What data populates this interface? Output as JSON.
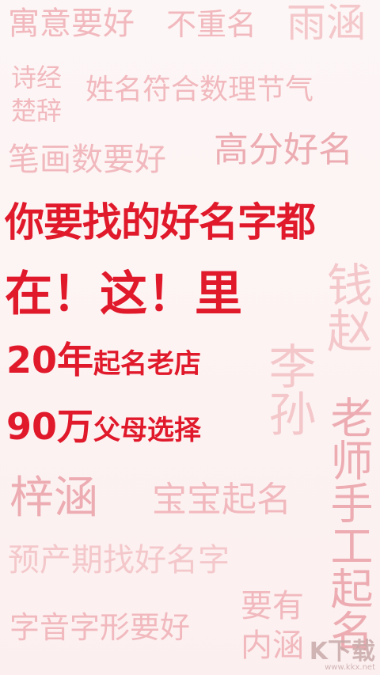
{
  "words": {
    "w1": "寓意要好",
    "w2": "不重名",
    "w3": "雨涵",
    "w4a": "诗经",
    "w4b": "楚辞",
    "w5": "姓名符合数理节气",
    "w6": "笔画数要好",
    "w7": "高分好名",
    "w8": "钱赵",
    "w9": "李孙",
    "w10": "老师手工起名",
    "w11": "梓涵",
    "w12": "宝宝起名",
    "w13": "预产期找好名字",
    "w14a": "要有",
    "w14b": "内涵",
    "w15": "字音字形要好"
  },
  "headline": {
    "line1": "你要找的好名字都",
    "line2": "在！这！里",
    "stat1_num": "20年",
    "stat1_text": "起名老店",
    "stat2_num": "90万",
    "stat2_text": "父母选择"
  },
  "watermark": {
    "logo": "K下载",
    "url": "www.kkx.net"
  },
  "colors": {
    "accent_red": "#e0192b",
    "soft_pink": "#f1b9be"
  }
}
